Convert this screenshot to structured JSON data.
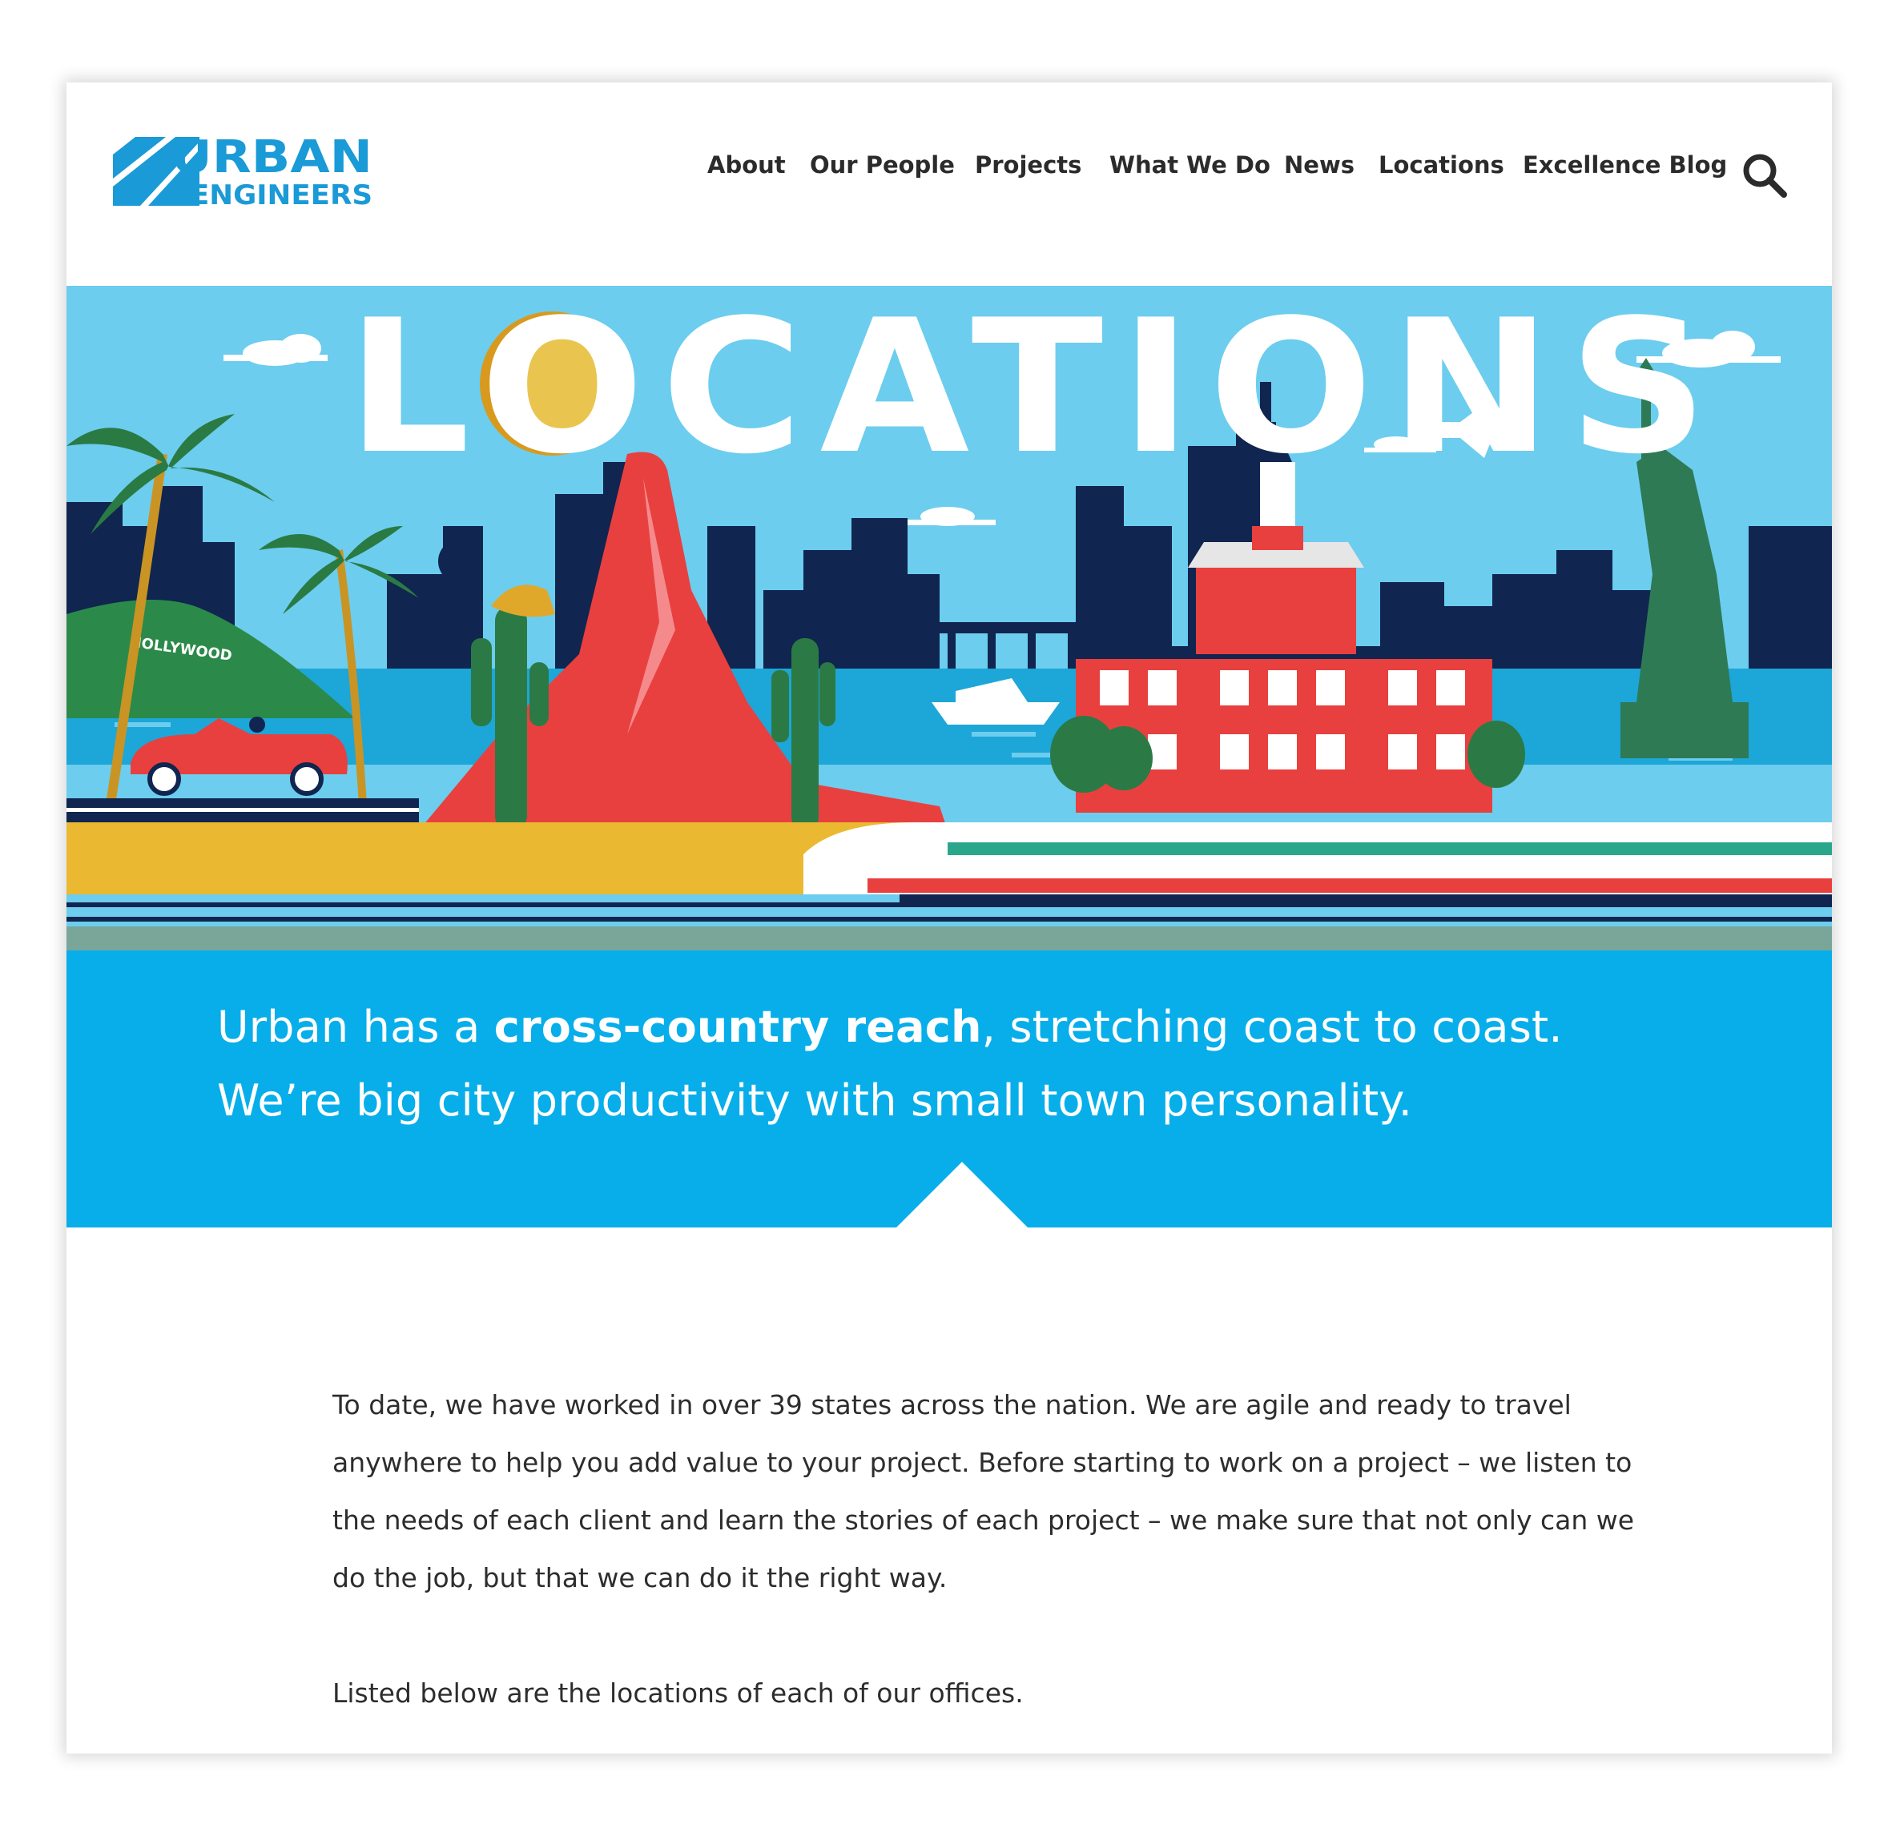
{
  "brand": {
    "logo_line1": "URBAN",
    "logo_line2": "ENGINEERS",
    "color": "#1a9ad6"
  },
  "nav": {
    "items": [
      "About",
      "Our People",
      "Projects",
      "What We Do",
      "News",
      "Locations",
      "Excellence Blog"
    ],
    "search_icon": "search-icon"
  },
  "hero": {
    "title": "LOCATIONS",
    "sign_text": "HOLLYWOOD",
    "sky_color": "#6ccdee",
    "sun_color": "#e9c550"
  },
  "intro": {
    "text_before": "Urban has a ",
    "text_bold": "cross-country reach",
    "text_after": ", stretching coast to coast. We’re big city productivity with small town personality.",
    "band_color": "#07aeea"
  },
  "body": {
    "paragraph1": "To date, we have worked in over 39 states across the nation. We are agile and ready to travel anywhere to help you add value to your project. Before starting to work on a project – we listen to the needs of each client and learn the stories of each project – we make sure that not only can we do the job, but that we can do it the right way.",
    "paragraph2": "Listed below are the locations of each of our offices."
  }
}
